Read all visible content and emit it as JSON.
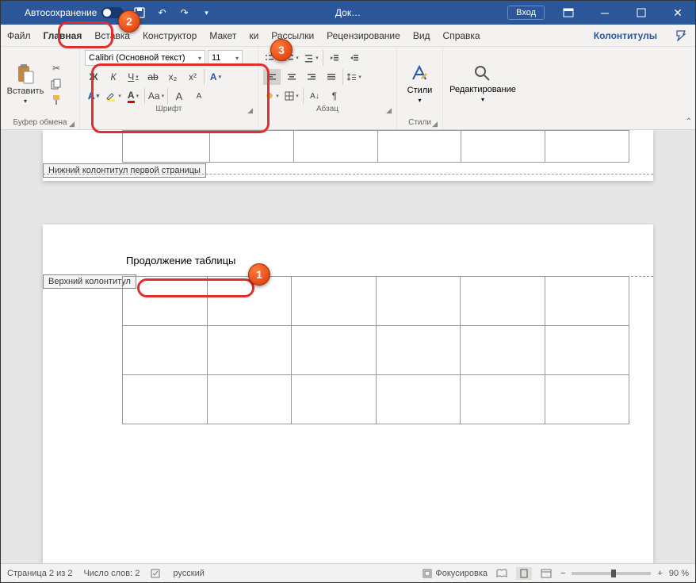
{
  "title": {
    "autosave": "Автосохранение",
    "doc": "Док…",
    "login": "Вход"
  },
  "tabs": {
    "file": "Файл",
    "home": "Главная",
    "insert": "Вставка",
    "design": "Конструктор",
    "layout": "Макет",
    "references": "ки",
    "mail": "Рассылки",
    "review": "Рецензирование",
    "view": "Вид",
    "help": "Справка",
    "contextual": "Колонтитулы"
  },
  "ribbon": {
    "clipboard": {
      "label": "Буфер обмена",
      "paste": "Вставить"
    },
    "font": {
      "label": "Шрифт",
      "name": "Calibri (Основной текст)",
      "size": "11",
      "bold": "Ж",
      "italic": "К",
      "underline": "Ч",
      "sub": "x₂",
      "sup": "x²",
      "aa": "Aa",
      "grow": "A",
      "shrink": "A"
    },
    "paragraph": {
      "label": "Абзац"
    },
    "styles": {
      "label": "Стили",
      "button": "Стили"
    },
    "editing": {
      "button": "Редактирование"
    }
  },
  "document": {
    "footer_tag": "Нижний колонтитул первой страницы",
    "header_tag": "Верхний колонтитул",
    "continuation": "Продолжение таблицы"
  },
  "status": {
    "page": "Страница 2 из 2",
    "words": "Число слов: 2",
    "lang": "русский",
    "focus": "Фокусировка",
    "zoom": "90 %"
  },
  "markers": {
    "m1": "1",
    "m2": "2",
    "m3": "3"
  }
}
